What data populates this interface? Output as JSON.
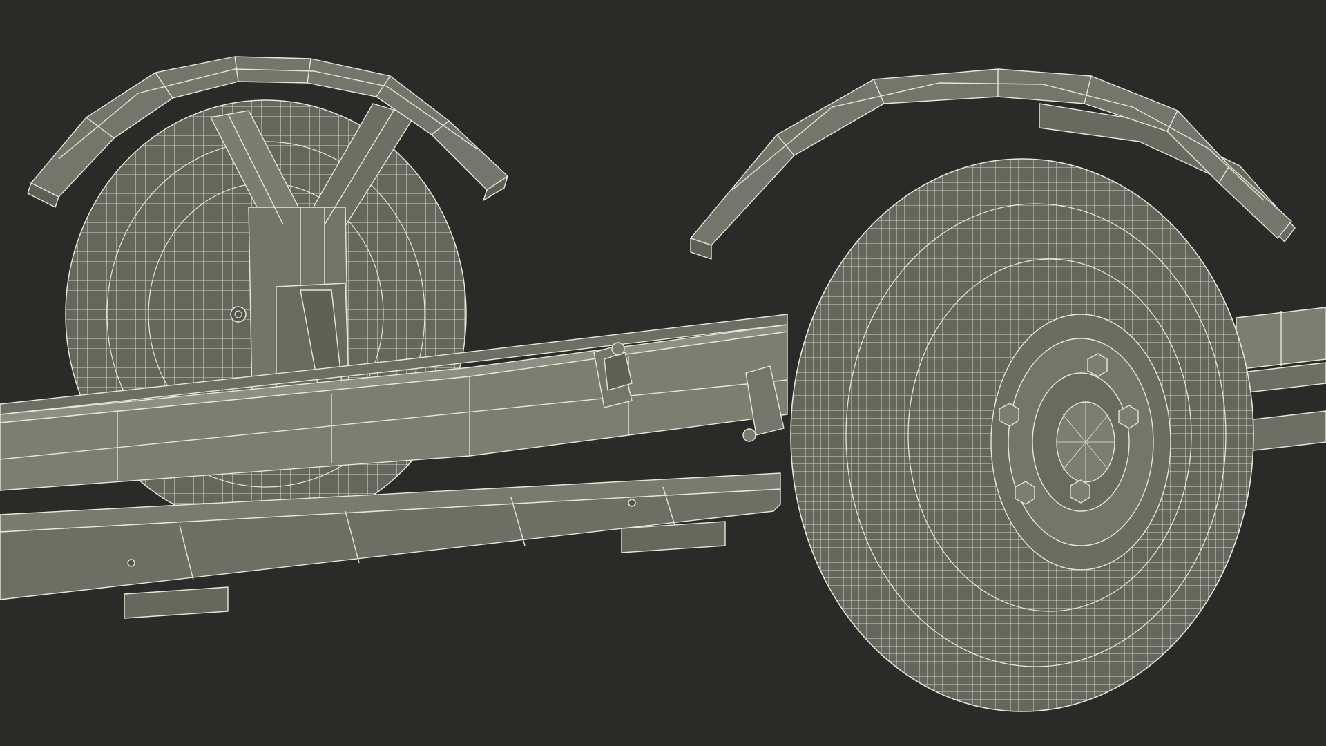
{
  "scene": {
    "subject": "trailer-chassis-wireframe-render",
    "colors": {
      "background": "#2a2a28",
      "surface": "#75766b",
      "surface_light": "#8a8b7f",
      "surface_dark": "#5b5c53",
      "tire": "#65665c",
      "wire": "#e6e6da"
    }
  }
}
